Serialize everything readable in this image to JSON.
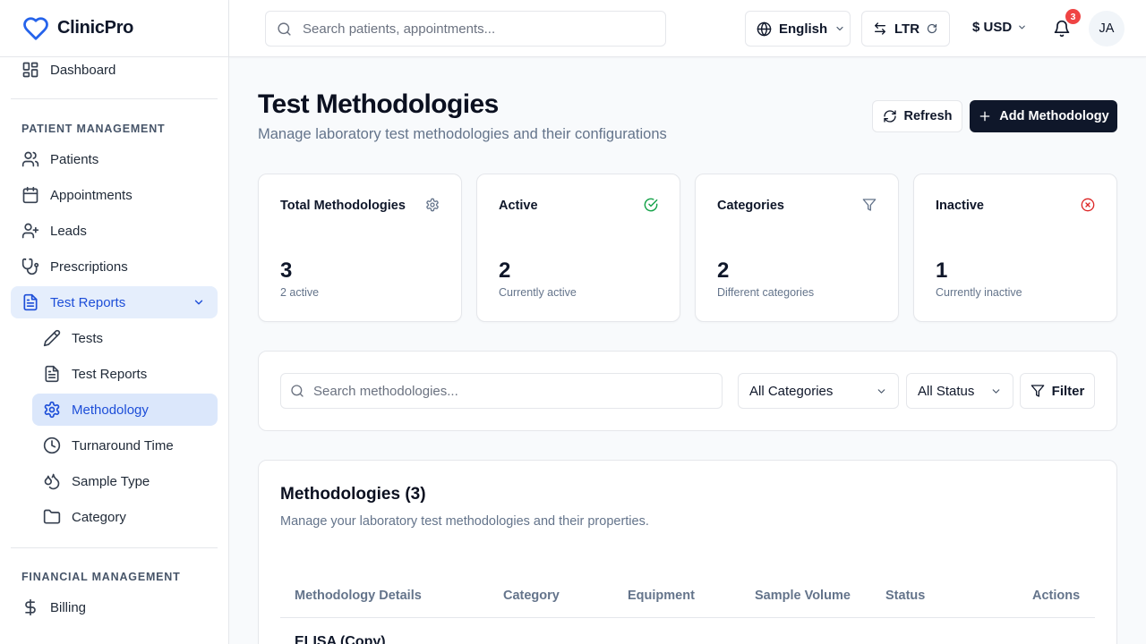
{
  "app": {
    "name": "ClinicPro",
    "brand_color": "#2563eb"
  },
  "sidebar": {
    "partial_item": "Dashboard",
    "sections": {
      "patient_management": "PATIENT MANAGEMENT",
      "financial_management": "FINANCIAL MANAGEMENT"
    },
    "items": {
      "patients": "Patients",
      "appointments": "Appointments",
      "leads": "Leads",
      "prescriptions": "Prescriptions",
      "test_reports": "Test Reports",
      "billing": "Billing"
    },
    "subitems": {
      "tests": "Tests",
      "test_reports": "Test Reports",
      "methodology": "Methodology",
      "turnaround_time": "Turnaround Time",
      "sample_type": "Sample Type",
      "category": "Category"
    }
  },
  "topbar": {
    "search_placeholder": "Search patients, appointments...",
    "language": "English",
    "direction": "LTR",
    "currency": "$ USD",
    "notifications_count": "3",
    "user_initials": "JA"
  },
  "page": {
    "title": "Test Methodologies",
    "subtitle": "Manage laboratory test methodologies and their configurations",
    "refresh_label": "Refresh",
    "add_label": "Add Methodology"
  },
  "stats": [
    {
      "title": "Total Methodologies",
      "value": "3",
      "note": "2 active",
      "icon": "gear-icon",
      "icon_color": "#64748b"
    },
    {
      "title": "Active",
      "value": "2",
      "note": "Currently active",
      "icon": "check-circle-icon",
      "icon_color": "#16a34a"
    },
    {
      "title": "Categories",
      "value": "2",
      "note": "Different categories",
      "icon": "filter-icon",
      "icon_color": "#64748b"
    },
    {
      "title": "Inactive",
      "value": "1",
      "note": "Currently inactive",
      "icon": "x-circle-icon",
      "icon_color": "#dc2626"
    }
  ],
  "filters": {
    "search_placeholder": "Search methodologies...",
    "category_select": "All Categories",
    "status_select": "All Status",
    "filter_label": "Filter"
  },
  "table": {
    "title": "Methodologies (3)",
    "subtitle": "Manage your laboratory test methodologies and their properties.",
    "columns": [
      "Methodology Details",
      "Category",
      "Equipment",
      "Sample Volume",
      "Status",
      "Actions"
    ],
    "rows": [
      {
        "name": "ELISA (Copy)"
      }
    ]
  }
}
